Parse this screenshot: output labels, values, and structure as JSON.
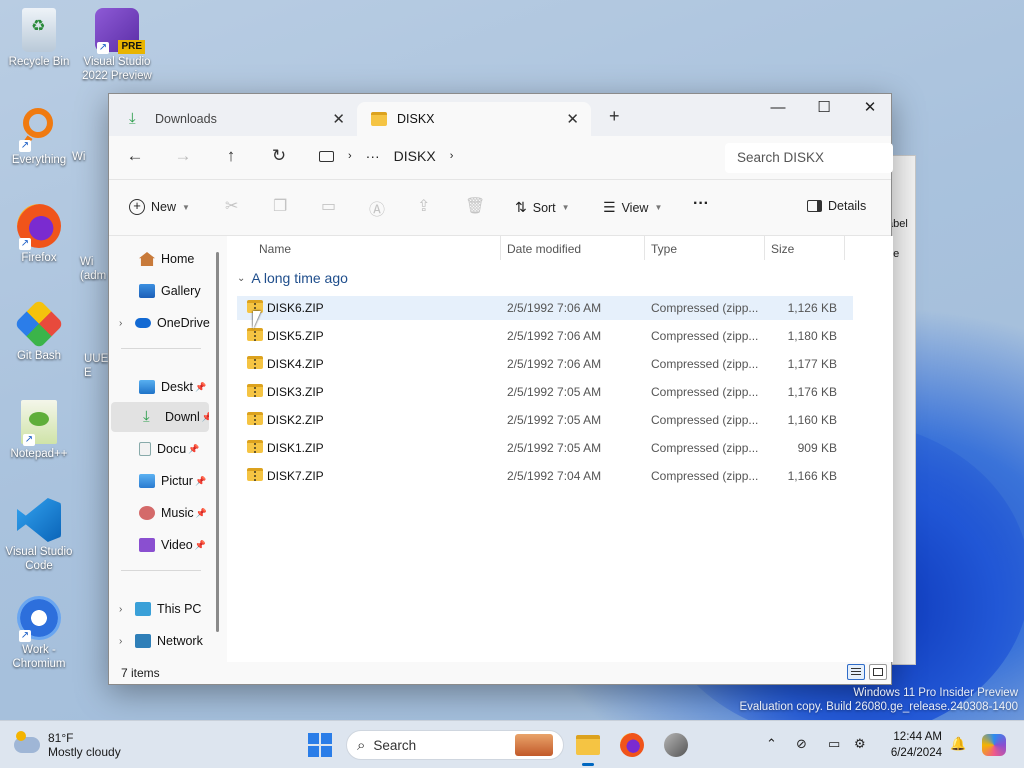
{
  "desktop": {
    "icons": [
      {
        "label": "Recycle Bin",
        "icon": "recycle-bin-icon"
      },
      {
        "label": "Visual Studio 2022 Preview",
        "icon": "visual-studio-icon",
        "badge": "PRE"
      },
      {
        "label": "Everything",
        "icon": "everything-search-icon"
      },
      {
        "label": "Firefox",
        "icon": "firefox-icon"
      },
      {
        "label": "Git Bash",
        "icon": "git-bash-icon"
      },
      {
        "label": "Notepad++",
        "icon": "notepadpp-icon"
      },
      {
        "label": "Visual Studio Code",
        "icon": "vscode-icon"
      },
      {
        "label": "Work - Chromium",
        "icon": "chromium-icon"
      }
    ],
    "partial_labels": [
      "Wi",
      "Wi (adm",
      "UUE E"
    ],
    "behind_window_labels": [
      "abel",
      "pe"
    ]
  },
  "explorer": {
    "tabs": [
      {
        "label": "Downloads",
        "icon": "download-icon",
        "active": false
      },
      {
        "label": "DISKX",
        "icon": "folder-icon",
        "active": true
      }
    ],
    "new_tab_label": "+",
    "window_controls": {
      "minimize": "—",
      "maximize": "☐",
      "close": "✕"
    },
    "breadcrumb": {
      "more": "···",
      "current": "DISKX"
    },
    "search_placeholder": "Search DISKX",
    "toolbar": {
      "new_label": "New",
      "sort_label": "Sort",
      "view_label": "View",
      "more_label": "···",
      "details_label": "Details"
    },
    "sidebar": {
      "items": [
        {
          "label": "Home",
          "icon": "home-icon"
        },
        {
          "label": "Gallery",
          "icon": "gallery-icon"
        },
        {
          "label": "OneDrive",
          "icon": "onedrive-icon"
        },
        {
          "label": "Deskt",
          "icon": "desktop-folder-icon",
          "pinned": true
        },
        {
          "label": "Downl",
          "icon": "downloads-folder-icon",
          "pinned": true,
          "selected": true
        },
        {
          "label": "Docu",
          "icon": "documents-folder-icon",
          "pinned": true
        },
        {
          "label": "Pictur",
          "icon": "pictures-folder-icon",
          "pinned": true
        },
        {
          "label": "Music",
          "icon": "music-folder-icon",
          "pinned": true
        },
        {
          "label": "Video",
          "icon": "videos-folder-icon",
          "pinned": true
        },
        {
          "label": "This PC",
          "icon": "this-pc-icon"
        },
        {
          "label": "Network",
          "icon": "network-icon"
        }
      ]
    },
    "columns": {
      "name": "Name",
      "date": "Date modified",
      "type": "Type",
      "size": "Size"
    },
    "group_label": "A long time ago",
    "files": [
      {
        "name": "DISK6.ZIP",
        "date": "2/5/1992 7:06 AM",
        "type": "Compressed (zipp...",
        "size": "1,126 KB"
      },
      {
        "name": "DISK5.ZIP",
        "date": "2/5/1992 7:06 AM",
        "type": "Compressed (zipp...",
        "size": "1,180 KB"
      },
      {
        "name": "DISK4.ZIP",
        "date": "2/5/1992 7:06 AM",
        "type": "Compressed (zipp...",
        "size": "1,177 KB"
      },
      {
        "name": "DISK3.ZIP",
        "date": "2/5/1992 7:05 AM",
        "type": "Compressed (zipp...",
        "size": "1,176 KB"
      },
      {
        "name": "DISK2.ZIP",
        "date": "2/5/1992 7:05 AM",
        "type": "Compressed (zipp...",
        "size": "1,160 KB"
      },
      {
        "name": "DISK1.ZIP",
        "date": "2/5/1992 7:05 AM",
        "type": "Compressed (zipp...",
        "size": "909 KB"
      },
      {
        "name": "DISK7.ZIP",
        "date": "2/5/1992 7:04 AM",
        "type": "Compressed (zipp...",
        "size": "1,166 KB"
      }
    ],
    "status_text": "7 items"
  },
  "watermark": {
    "line1": "Windows 11 Pro Insider Preview",
    "line2": "Evaluation copy. Build 26080.ge_release.240308-1400"
  },
  "taskbar": {
    "weather_temp": "81°F",
    "weather_desc": "Mostly cloudy",
    "search_label": "Search",
    "time": "12:44 AM",
    "date": "6/24/2024"
  },
  "colors": {
    "accent": "#0067c0",
    "folder": "#f5c443",
    "hover_row": "#e6f0fb"
  }
}
